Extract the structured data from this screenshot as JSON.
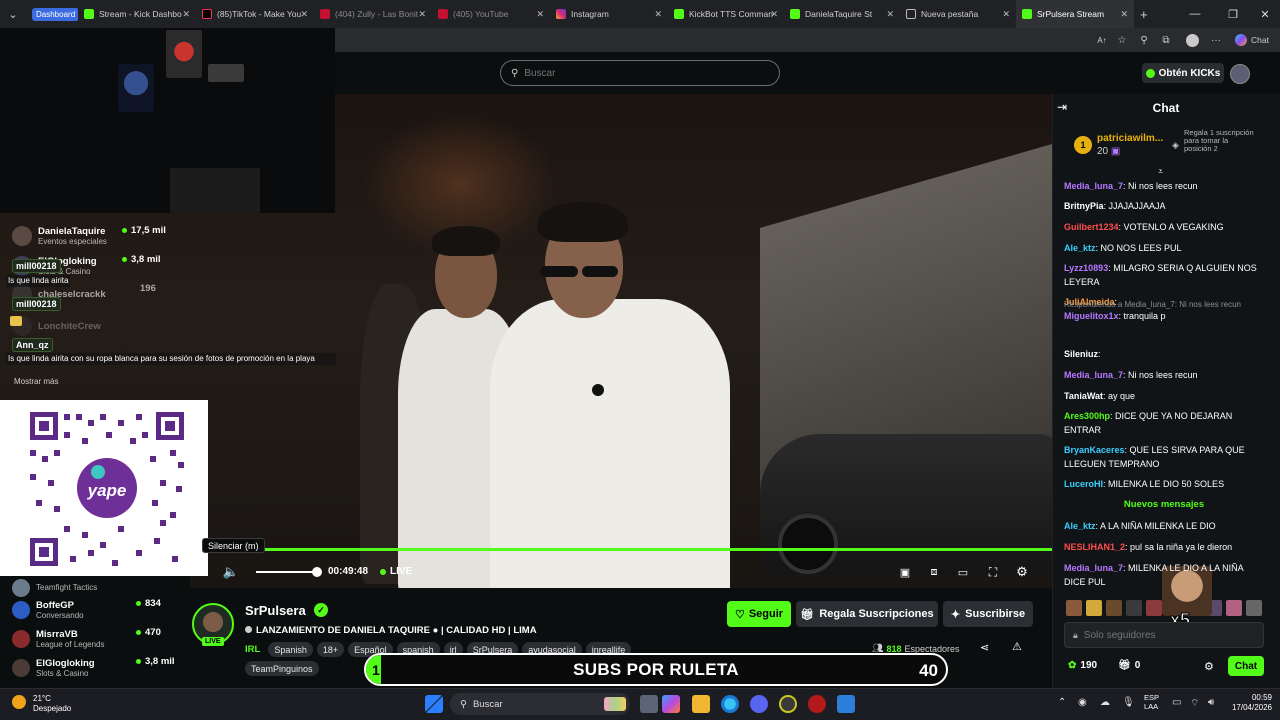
{
  "browser": {
    "tabs": [
      {
        "label": "Dashboard",
        "icon": "dashboard-badge"
      },
      {
        "label": "Stream - Kick Dashbo",
        "icon": "kick-icon"
      },
      {
        "label": "(85)TikTok - Make You",
        "icon": "tiktok-icon"
      },
      {
        "label": "(404) Zully - Las Bonit",
        "icon": "youtube-icon"
      },
      {
        "label": "(405) YouTube",
        "icon": "youtube-icon"
      },
      {
        "label": "Instagram",
        "icon": "instagram-icon"
      },
      {
        "label": "KickBot TTS Comman",
        "icon": "kick-icon"
      },
      {
        "label": "DanielaTaquire St",
        "icon": "kick-icon"
      },
      {
        "label": "Nueva pestaña",
        "icon": "newtab-icon"
      },
      {
        "label": "SrPulsera Stream",
        "icon": "kick-icon"
      }
    ],
    "new_tab": "+",
    "copilot_label": "Chat"
  },
  "header": {
    "search_placeholder": "Buscar",
    "kicks_label": "Obtén KICKs"
  },
  "overlay": {
    "streamers": [
      {
        "name": "DanielaTaquire",
        "category": "Eventos especiales",
        "viewers": "17,5 mil"
      },
      {
        "name": "ElGlogloking",
        "category": "Slots & Casino",
        "viewers": "3,8 mil"
      },
      {
        "name": "chaleselcrackk",
        "category": "",
        "viewers": "196"
      },
      {
        "name": "LonchiteCrew",
        "category": "",
        "viewers": ""
      }
    ],
    "chat": [
      {
        "user": "mill00218",
        "msg": "Is que linda airita"
      },
      {
        "user": "mill00218",
        "msg": ""
      },
      {
        "user": "Ann_qz",
        "msg": "Is que linda airita con su ropa blanca para su sesión de fotos de promoción en la playa"
      }
    ],
    "show_more": "Mostrar más"
  },
  "player": {
    "tooltip": "Silenciar (m)",
    "time": "00:49:48",
    "live_label": "LIVE"
  },
  "sidebar_lower": [
    {
      "name": "",
      "category": "Teamfight Tactics",
      "viewers": ""
    },
    {
      "name": "BoffeGP",
      "category": "Conversando",
      "viewers": "834"
    },
    {
      "name": "MisrraVB",
      "category": "League of Legends",
      "viewers": "470"
    },
    {
      "name": "ElGlogloking",
      "category": "Slots & Casino",
      "viewers": "3,8 mil"
    }
  ],
  "channel": {
    "name": "SrPulsera",
    "live_badge": "LIVE",
    "title": "LANZAMIENTO DE DANIELA TAQUIRE  ●  | CALIDAD HD | LIMA",
    "category": "IRL",
    "tags": [
      "Spanish",
      "18+",
      "Español",
      "spanish",
      "irl",
      "SrPulsera",
      "ayudasocial",
      "inreallife",
      "TeamPinguinos"
    ],
    "viewers": "818",
    "viewers_label": "Espectadores",
    "follow_label": "Seguir",
    "gift_label": "Regala Suscripciones",
    "subscribe_label": "Suscribirse"
  },
  "subs_banner": {
    "text": "SUBS POR RULETA",
    "current": "1",
    "goal": "40",
    "progress": 0.025
  },
  "chat": {
    "title": "Chat",
    "pinned": {
      "rank": "1",
      "name": "patriciawilm...",
      "count": "20",
      "gift_text": "Regala 1 suscripción para tomar la posición 2"
    },
    "messages": [
      {
        "user": "Media_luna_7",
        "color": "#b678ff",
        "text": ": Ni nos lees recun"
      },
      {
        "user": "BritnyPia",
        "color": "#ffffff",
        "text": ": JJAJAJJAAJA"
      },
      {
        "user": "Guilbert1234",
        "color": "#ff4d4d",
        "text": ": VOTENLO A VEGAKING"
      },
      {
        "user": "Ale_ktz",
        "color": "#39d0ff",
        "text": ": NO NOS LEES PUL"
      },
      {
        "user": "Lyzz10893",
        "color": "#b678ff",
        "text": ": MILAGRO SERIA Q ALGUIEN NOS LEYERA"
      },
      {
        "user": "JuliAlmeida",
        "color": "#ff9a3c",
        "text": ":"
      },
      {
        "user": "Miguelitox1x",
        "color": "#b678ff",
        "text": ": tranquila p",
        "reply": "Respondiendo a Media_luna_7: Ni nos lees recun"
      },
      {
        "user": "Sileniuz",
        "color": "#ffffff",
        "text": ":"
      },
      {
        "user": "Media_luna_7",
        "color": "#b678ff",
        "text": ": Ni nos lees recun"
      },
      {
        "user": "TaniaWat",
        "color": "#ffffff",
        "text": ": ay que"
      },
      {
        "user": "Ares300hp",
        "color": "#53fc18",
        "text": ": DICE QUE YA NO DEJARAN ENTRAR"
      },
      {
        "user": "BryanKaceres",
        "color": "#39d0ff",
        "text": ": QUE LES SIRVA PARA QUE LLEGUEN TEMPRANO"
      },
      {
        "user": "LuceroHI",
        "color": "#39d0ff",
        "text": ": MILENKA LE DIO 50 SOLES"
      },
      {
        "user": "Ale_ktz",
        "color": "#39d0ff",
        "text": ": A LA NIÑA MILENKA LE DIO"
      },
      {
        "user": "NESLIHAN1_2",
        "color": "#ff4d4d",
        "text": ": pul sa la niña ya le dieron"
      },
      {
        "user": "Media_luna_7",
        "color": "#b678ff",
        "text": ": MILENKA LE DIO A LA NIÑA DICE PUL"
      }
    ],
    "new_messages": "Nuevos mensajes",
    "input_placeholder": "Solo seguidores",
    "points": "190",
    "gifts": "0",
    "send_label": "Chat",
    "emote_overlay": "x5"
  },
  "taskbar": {
    "weather_temp": "21°C",
    "weather_desc": "Despejado",
    "search_placeholder": "Buscar",
    "lang_top": "ESP",
    "lang_bottom": "LAA",
    "time": "00:59",
    "date": "17/04/2026"
  }
}
